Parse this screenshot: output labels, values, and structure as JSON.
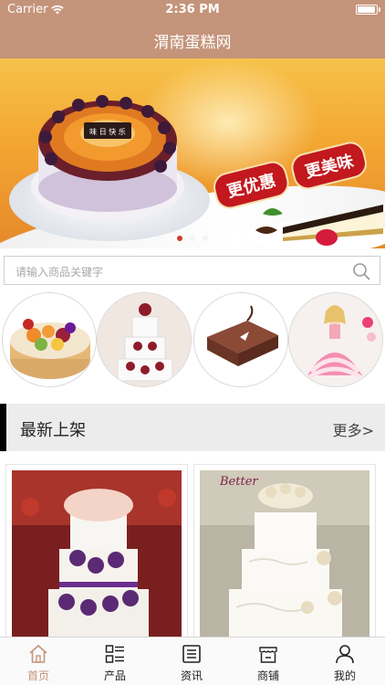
{
  "status_bar": {
    "carrier": "Carrier",
    "time": "2:36 PM"
  },
  "nav": {
    "title": "渭南蛋糕网"
  },
  "banner": {
    "slogans": [
      "更优惠",
      "更美味"
    ],
    "cake_plaque": "味 日 快 乐",
    "dots": 3,
    "active_dot": 0
  },
  "search": {
    "placeholder": "请输入商品关键字"
  },
  "categories": [
    {
      "name": "fruit-cake-category"
    },
    {
      "name": "tiered-cake-category"
    },
    {
      "name": "chocolate-cake-category"
    },
    {
      "name": "doll-cake-category"
    }
  ],
  "section": {
    "title": "最新上架",
    "more": "更多>"
  },
  "products": [
    {
      "name": "purple-rose-tiered-cake"
    },
    {
      "name": "white-flower-tiered-cake",
      "image_text": "Better"
    }
  ],
  "tabbar": {
    "items": [
      {
        "label": "首页",
        "icon": "home-icon",
        "active": true
      },
      {
        "label": "产品",
        "icon": "grid-list-icon",
        "active": false
      },
      {
        "label": "资讯",
        "icon": "news-icon",
        "active": false
      },
      {
        "label": "商铺",
        "icon": "shop-icon",
        "active": false
      },
      {
        "label": "我的",
        "icon": "user-icon",
        "active": false
      }
    ]
  },
  "colors": {
    "brand": "#c4947a",
    "active_dot": "#d23b2c",
    "slogan": "#c2181e"
  }
}
